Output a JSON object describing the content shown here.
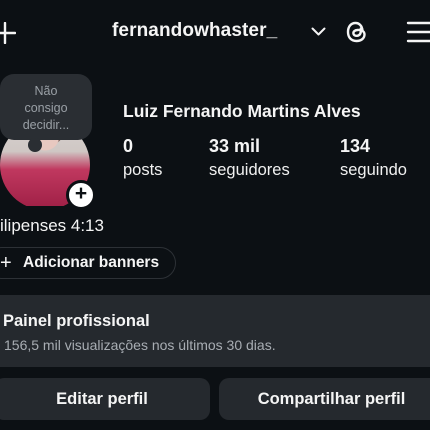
{
  "header": {
    "username": "fernandowhaster_",
    "icons": [
      "plus-icon",
      "chevron-down-icon",
      "threads-icon",
      "menu-icon"
    ]
  },
  "note": {
    "text": "Não consigo decidir..."
  },
  "profile": {
    "full_name": "Luiz Fernando Martins Alves",
    "stats": [
      {
        "value": "0",
        "label": "posts"
      },
      {
        "value": "33 mil",
        "label": "seguidores"
      },
      {
        "value": "134",
        "label": "seguindo"
      }
    ],
    "bio": "ilipenses 4:13"
  },
  "banners": {
    "label": "Adicionar banners"
  },
  "panel": {
    "title": "Painel profissional",
    "subtitle": "156,5 mil visualizações nos últimos 30 dias."
  },
  "actions": {
    "edit_label": "Editar perfil",
    "share_label": "Compartilhar perfil"
  },
  "colors": {
    "background": "#0c1014",
    "surface": "#25292e",
    "text": "#f5f5f5",
    "muted": "#a8adb3"
  }
}
